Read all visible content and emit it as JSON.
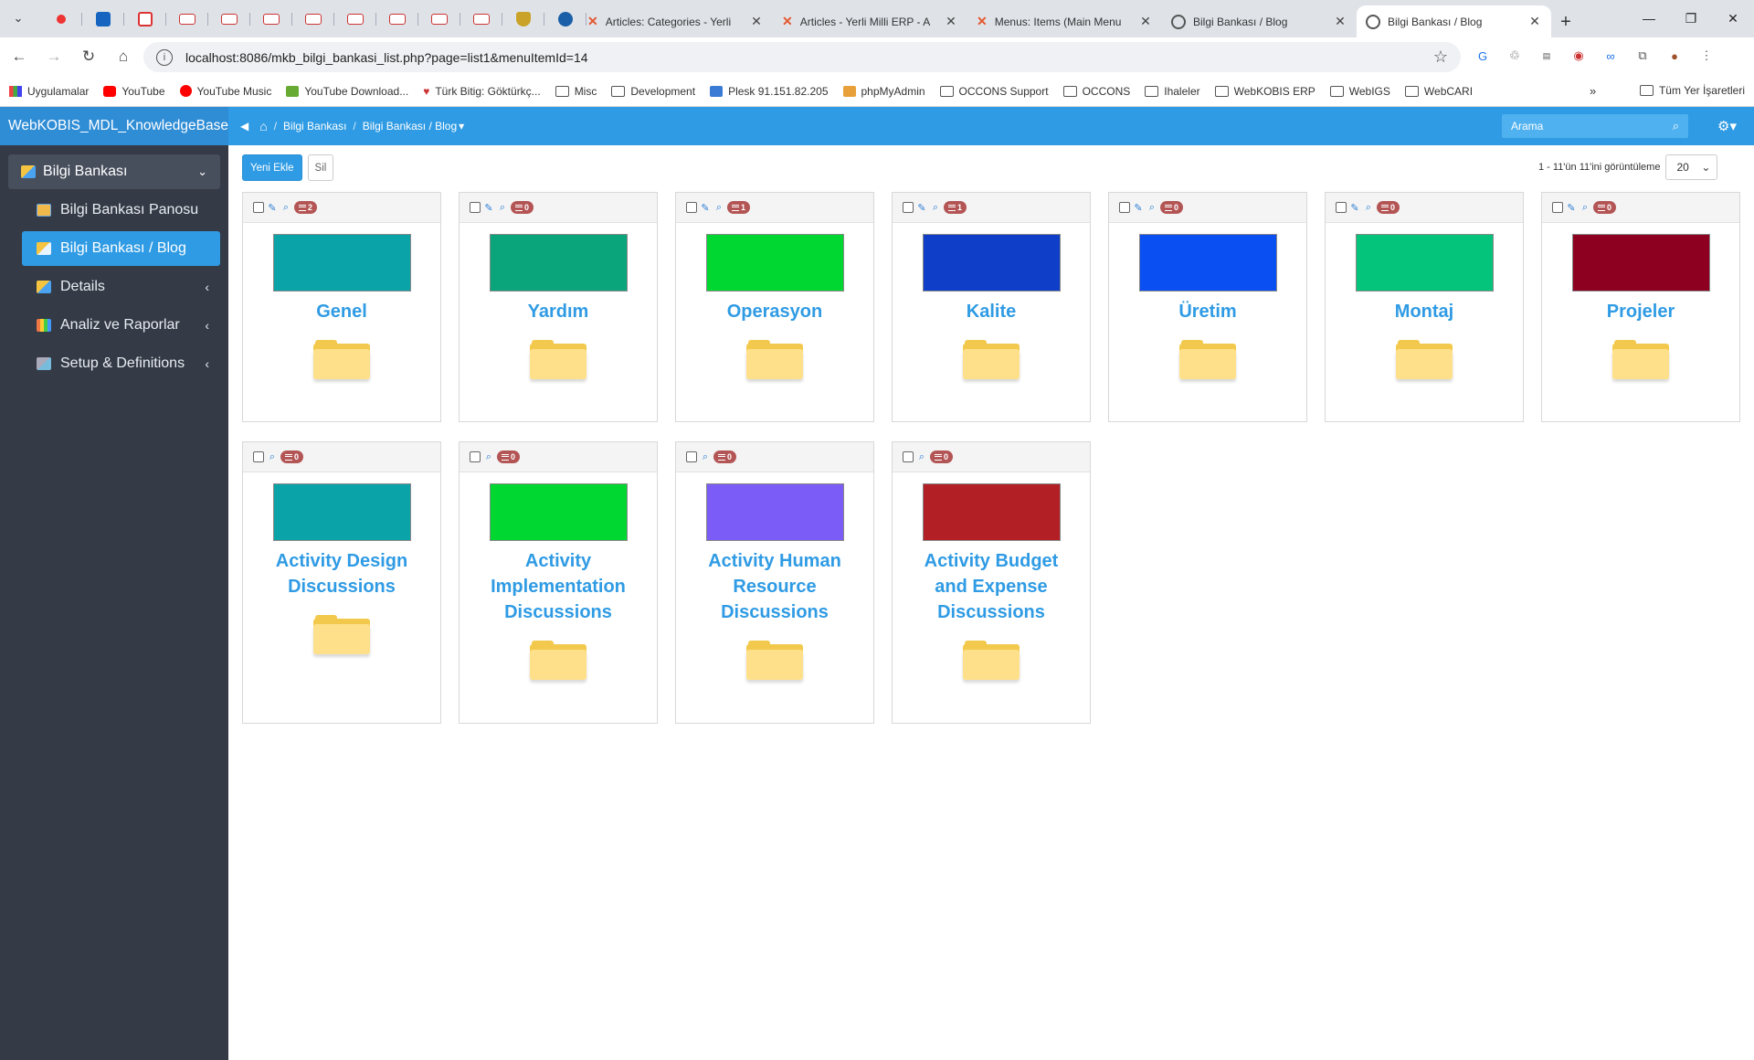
{
  "browser": {
    "tabs": [
      {
        "title": "Articles: Categories - Yerli",
        "active": false
      },
      {
        "title": "Articles - Yerli Milli ERP - A",
        "active": false
      },
      {
        "title": "Menus: Items (Main Menu",
        "active": false
      },
      {
        "title": "Bilgi Bankası / Blog",
        "active": false
      },
      {
        "title": "Bilgi Bankası / Blog",
        "active": true
      }
    ],
    "url": "localhost:8086/mkb_bilgi_bankasi_list.php?page=list1&menuItemId=14",
    "bookmarks": [
      {
        "label": "Uygulamalar",
        "icon": "apps-grid-icon"
      },
      {
        "label": "YouTube",
        "icon": "youtube-icon"
      },
      {
        "label": "YouTube Music",
        "icon": "youtube-music-icon"
      },
      {
        "label": "YouTube Download...",
        "icon": "download-icon"
      },
      {
        "label": "Türk Bitig: Göktürkç...",
        "icon": "bitig-icon"
      },
      {
        "label": "Misc",
        "icon": "folder-icon"
      },
      {
        "label": "Development",
        "icon": "folder-icon"
      },
      {
        "label": "Plesk 91.151.82.205",
        "icon": "plesk-icon"
      },
      {
        "label": "phpMyAdmin",
        "icon": "phpmyadmin-icon"
      },
      {
        "label": "OCCONS Support",
        "icon": "folder-icon"
      },
      {
        "label": "OCCONS",
        "icon": "folder-icon"
      },
      {
        "label": "Ihaleler",
        "icon": "folder-icon"
      },
      {
        "label": "WebKOBIS ERP",
        "icon": "folder-icon"
      },
      {
        "label": "WebIGS",
        "icon": "folder-icon"
      },
      {
        "label": "WebCARI",
        "icon": "folder-icon"
      }
    ],
    "bookmarks_all": "Tüm Yer İşaretleri",
    "bookmarks_more": "»"
  },
  "app": {
    "brand": "WebKOBIS_MDL_KnowledgeBase",
    "sidebar": {
      "group": "Bilgi Bankası",
      "items": [
        {
          "label": "Bilgi Bankası Panosu",
          "active": false,
          "submenu": false
        },
        {
          "label": "Bilgi Bankası / Blog",
          "active": true,
          "submenu": false
        },
        {
          "label": "Details",
          "active": false,
          "submenu": true
        },
        {
          "label": "Analiz ve Raporlar",
          "active": false,
          "submenu": true
        },
        {
          "label": "Setup & Definitions",
          "active": false,
          "submenu": true
        }
      ]
    },
    "breadcrumb": [
      "Bilgi Bankası",
      "Bilgi Bankası / Blog"
    ],
    "search_placeholder": "Arama",
    "actions": {
      "add": "Yeni Ekle",
      "delete": "Sil"
    },
    "pager": {
      "summary": "1 - 11'ün 11'ini görüntüleme",
      "page_size": "20"
    },
    "categories": [
      {
        "title": "Genel",
        "count": "2",
        "color": "#0aa3a8",
        "editable": true
      },
      {
        "title": "Yardım",
        "count": "0",
        "color": "#0aa57a",
        "editable": true
      },
      {
        "title": "Operasyon",
        "count": "1",
        "color": "#00d731",
        "editable": true
      },
      {
        "title": "Kalite",
        "count": "1",
        "color": "#0f3fc8",
        "editable": true
      },
      {
        "title": "Üretim",
        "count": "0",
        "color": "#0a4ff2",
        "editable": true
      },
      {
        "title": "Montaj",
        "count": "0",
        "color": "#04c47c",
        "editable": true
      },
      {
        "title": "Projeler",
        "count": "0",
        "color": "#8e0020",
        "editable": true
      },
      {
        "title": "Activity Design Discussions",
        "count": "0",
        "color": "#0aa3a8",
        "editable": false
      },
      {
        "title": "Activity Implementation Discussions",
        "count": "0",
        "color": "#00d731",
        "editable": false
      },
      {
        "title": "Activity Human Resource Discussions",
        "count": "0",
        "color": "#7b5cf7",
        "editable": false
      },
      {
        "title": "Activity Budget and Expense Discussions",
        "count": "0",
        "color": "#b21f25",
        "editable": false
      }
    ]
  }
}
